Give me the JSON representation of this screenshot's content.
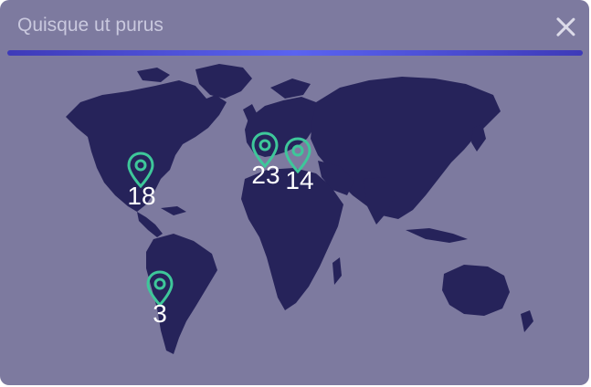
{
  "dialog": {
    "title": "Quisque ut purus",
    "accent_color": "#4f55e6",
    "close_icon": "close-icon"
  },
  "markers": [
    {
      "id": "north-america",
      "value": "18",
      "icon": "location-pin-icon",
      "color": "#3ec79a"
    },
    {
      "id": "western-europe",
      "value": "23",
      "icon": "location-pin-icon",
      "color": "#3ec79a"
    },
    {
      "id": "eastern-europe",
      "value": "14",
      "icon": "location-pin-icon",
      "color": "#3ec79a"
    },
    {
      "id": "south-america",
      "value": "3",
      "icon": "location-pin-icon",
      "color": "#3ec79a"
    }
  ]
}
